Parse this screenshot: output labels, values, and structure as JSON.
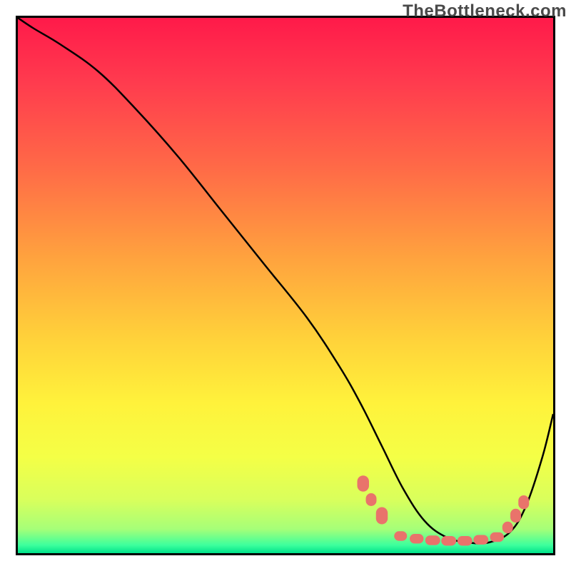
{
  "watermark": "TheBottleneck.com",
  "chart_data": {
    "type": "line",
    "title": "",
    "xlabel": "",
    "ylabel": "",
    "xlim": [
      0,
      100
    ],
    "ylim": [
      0,
      100
    ],
    "grid": false,
    "legend": false,
    "background": {
      "type": "vertical-gradient",
      "stops": [
        {
          "pos": 0.0,
          "color": "#ff1a4a"
        },
        {
          "pos": 0.12,
          "color": "#ff3b4e"
        },
        {
          "pos": 0.28,
          "color": "#ff6a47"
        },
        {
          "pos": 0.45,
          "color": "#ffa33e"
        },
        {
          "pos": 0.6,
          "color": "#ffd23a"
        },
        {
          "pos": 0.72,
          "color": "#fff23b"
        },
        {
          "pos": 0.82,
          "color": "#f4ff46"
        },
        {
          "pos": 0.9,
          "color": "#d9ff5c"
        },
        {
          "pos": 0.955,
          "color": "#a6ff78"
        },
        {
          "pos": 0.985,
          "color": "#3dff9d"
        },
        {
          "pos": 1.0,
          "color": "#00e28a"
        }
      ]
    },
    "series": [
      {
        "name": "bottleneck-curve",
        "color": "#000000",
        "stroke_width": 2.5,
        "x": [
          0,
          3,
          8,
          15,
          22,
          30,
          38,
          46,
          54,
          60,
          64,
          68,
          72,
          76,
          80,
          84,
          88,
          92,
          95,
          98,
          100
        ],
        "y": [
          100,
          98,
          95,
          90,
          83,
          74,
          64,
          54,
          44,
          35,
          28,
          20,
          12,
          6,
          3,
          2,
          2,
          4,
          9,
          18,
          26
        ]
      }
    ],
    "markers": {
      "name": "highlight-dots",
      "color": "#e9736b",
      "shape": "rounded-rect",
      "points": [
        {
          "x": 64.5,
          "y": 13.0,
          "w": 2.2,
          "h": 3.0
        },
        {
          "x": 66.0,
          "y": 10.0,
          "w": 2.0,
          "h": 2.4
        },
        {
          "x": 68.0,
          "y": 7.0,
          "w": 2.2,
          "h": 3.2
        },
        {
          "x": 71.5,
          "y": 3.2,
          "w": 2.4,
          "h": 1.8
        },
        {
          "x": 74.5,
          "y": 2.7,
          "w": 2.6,
          "h": 1.8
        },
        {
          "x": 77.5,
          "y": 2.4,
          "w": 2.8,
          "h": 1.8
        },
        {
          "x": 80.5,
          "y": 2.3,
          "w": 2.8,
          "h": 1.8
        },
        {
          "x": 83.5,
          "y": 2.3,
          "w": 2.8,
          "h": 1.8
        },
        {
          "x": 86.5,
          "y": 2.5,
          "w": 2.8,
          "h": 1.8
        },
        {
          "x": 89.5,
          "y": 3.0,
          "w": 2.6,
          "h": 1.8
        },
        {
          "x": 91.5,
          "y": 4.8,
          "w": 2.0,
          "h": 2.2
        },
        {
          "x": 93.0,
          "y": 7.0,
          "w": 2.0,
          "h": 2.6
        },
        {
          "x": 94.5,
          "y": 9.5,
          "w": 2.0,
          "h": 2.6
        }
      ]
    }
  }
}
